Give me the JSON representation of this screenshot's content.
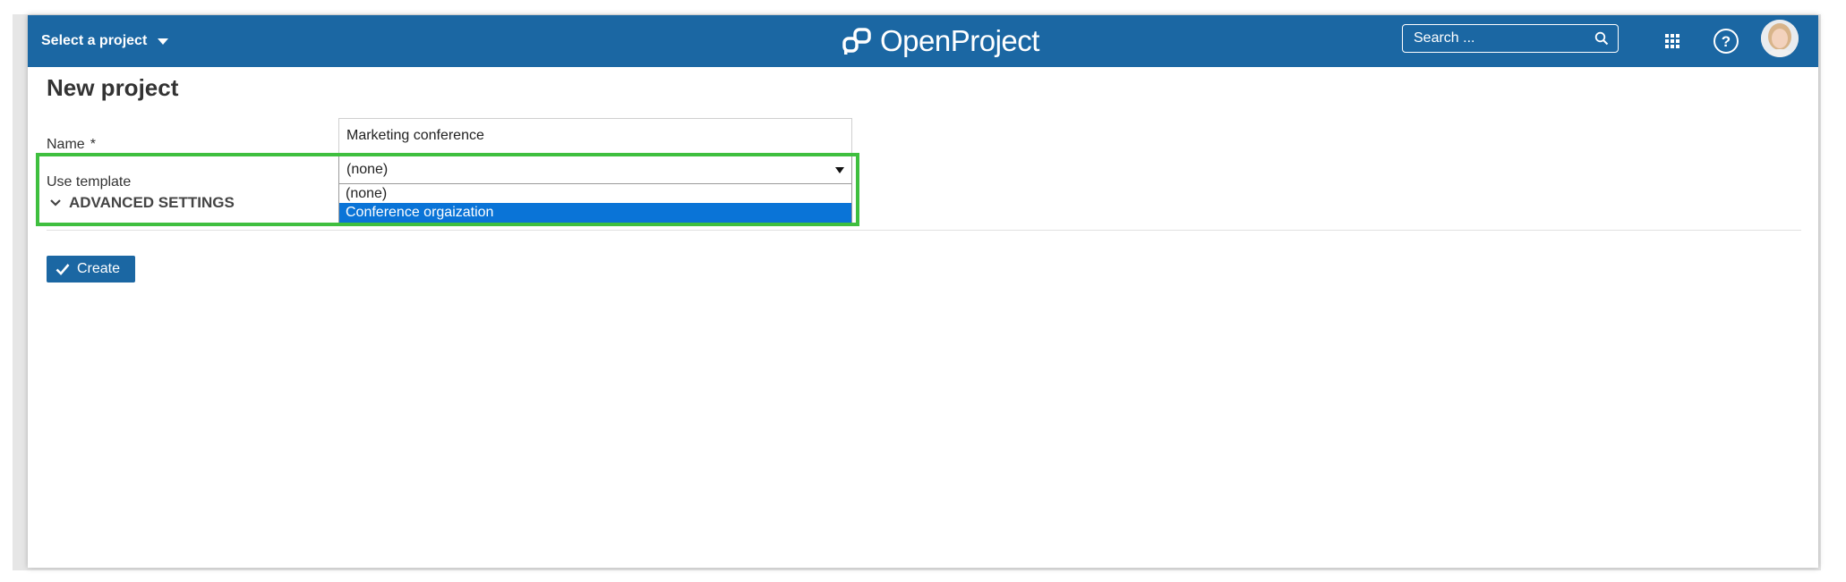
{
  "header": {
    "project_selector": "Select a project",
    "logo_text": "OpenProject",
    "search_placeholder": "Search ...",
    "brand_color": "#1b67a3"
  },
  "form": {
    "title": "New project",
    "name_label": "Name",
    "required_marker": "*",
    "name_value": "Marketing conference",
    "template_label": "Use template",
    "template_selected": "(none)",
    "template_options": [
      "(none)",
      "Conference orgaization"
    ],
    "highlighted_option": "Conference orgaization",
    "advanced_label": "ADVANCED SETTINGS",
    "create_label": "Create"
  },
  "annotation": {
    "highlight_color": "#3fbf3f"
  }
}
